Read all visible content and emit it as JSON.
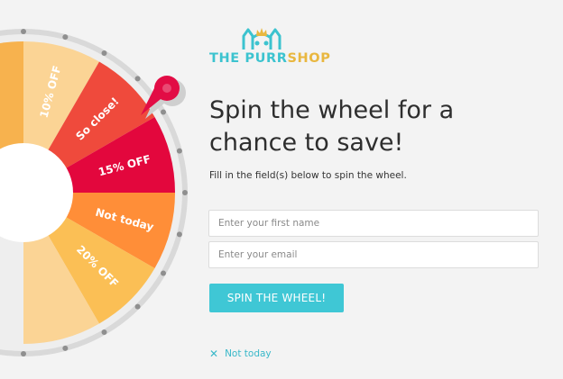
{
  "brand": {
    "name_part1": "THE PURR",
    "name_part2": "SHOP",
    "logo_icon": "cat-crown-icon",
    "colors": {
      "teal": "#3cc3cf",
      "gold": "#e9b73f"
    }
  },
  "wheel": {
    "segments": [
      {
        "label": "",
        "color": "#f7b24e"
      },
      {
        "label": "10% OFF",
        "color": "#fbd495"
      },
      {
        "label": "So close!",
        "color": "#ef4a3c"
      },
      {
        "label": "15% OFF",
        "color": "#e3073d"
      },
      {
        "label": "Not today",
        "color": "#ff8e38"
      },
      {
        "label": "20% OFF",
        "color": "#fbbf55"
      },
      {
        "label": "",
        "color": "#fbd495"
      }
    ],
    "rim_color": "#d9d9d9",
    "pointer_color": "#e20c45",
    "pointer_icon": "map-pin-pointer-icon"
  },
  "headline": "Spin the wheel for a chance to save!",
  "subtext": "Fill in the field(s) below to spin the wheel.",
  "form": {
    "first_name_placeholder": "Enter your first name",
    "email_placeholder": "Enter your email",
    "spin_button_label": "SPIN THE WHEEL!"
  },
  "dismiss": {
    "icon": "close-icon",
    "label": "Not today"
  }
}
